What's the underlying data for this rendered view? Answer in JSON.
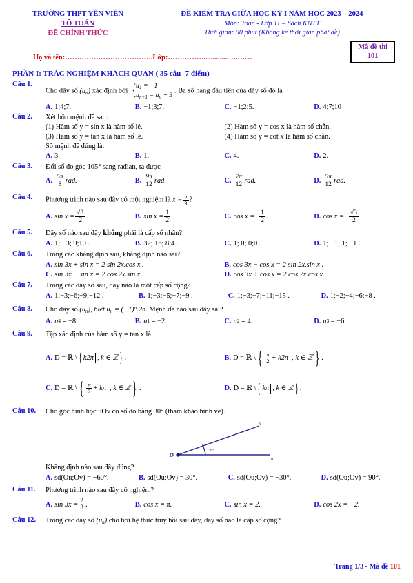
{
  "header": {
    "school": "TRƯỜNG THPT YÊN VIÊN",
    "department": "TỔ TOÁN",
    "official": "ĐỀ CHÍNH THỨC",
    "exam_title": "ĐỀ KIỂM TRA GIỮA HỌC KỲ I NĂM HỌC 2023 – 2024",
    "subject": "Môn: Toán - Lớp 11 – Sách KNTT",
    "duration": "Thời gian: 90 phút (Không kể thời gian phát đề)"
  },
  "student": {
    "name_label": "Họ và tên:……………………………….",
    "class_label": "Lớp:……………..............….……",
    "code_title": "Mã đề thi",
    "code_value": "101"
  },
  "part_heading": "PHẦN I: TRẮC NGHIỆM KHÁCH QUAN ( 35 câu- 7 điểm)",
  "questions": [
    {
      "label": "Câu 1.",
      "stem_pre": "Cho dãy số",
      "stem_seq": "(u",
      "stem_seq_sub": "n",
      "stem_seq_post": ")",
      "stem_mid": "xác định bởi",
      "sys_line1_a": "u",
      "sys_line1_sub": "1",
      "sys_line1_b": "= −1",
      "sys_line2_a": "u",
      "sys_line2_sub": "n+1",
      "sys_line2_b": "= u",
      "sys_line2_sub2": "n",
      "sys_line2_c": "+ 3",
      "stem_post": ". Ba số hạng đầu tiên của dãy số đó là",
      "options": [
        {
          "letter": "A.",
          "text": "1;4;7."
        },
        {
          "letter": "B.",
          "text": "−1;3;7."
        },
        {
          "letter": "C.",
          "text": "−1;2;5."
        },
        {
          "letter": "D.",
          "text": "4;7;10"
        }
      ]
    },
    {
      "label": "Câu 2.",
      "stem": "Xét bốn mệnh đề sau:",
      "statements": [
        "(1) Hàm số  y = sin x  là hàm số lẻ.",
        "(2) Hàm số  y = cos x  là hàm số chẵn.",
        "(3) Hàm số  y = tan x  là hàm số lẻ.",
        "(4) Hàm số  y = cot x  là hàm số chẵn."
      ],
      "stem2": "Số mệnh đề đúng là:",
      "options": [
        {
          "letter": "A.",
          "text": "3."
        },
        {
          "letter": "B.",
          "text": "1."
        },
        {
          "letter": "C.",
          "text": "4."
        },
        {
          "letter": "D.",
          "text": "2."
        }
      ]
    },
    {
      "label": "Câu 3.",
      "stem": "Đổi số đo góc 105° sang rađian, ta được",
      "options": [
        {
          "letter": "A.",
          "num": "5π",
          "den": "8",
          "unit": "rad."
        },
        {
          "letter": "B.",
          "num": "9π",
          "den": "12",
          "unit": "rad."
        },
        {
          "letter": "C.",
          "num": "7π",
          "den": "12",
          "unit": "rad."
        },
        {
          "letter": "D.",
          "num": "5π",
          "den": "12",
          "unit": "rad."
        }
      ]
    },
    {
      "label": "Câu 4.",
      "stem_pre": "Phương trình nào sau đây có một nghiệm là",
      "stem_x": "x =",
      "stem_num": "π",
      "stem_den": "3",
      "stem_post": "?",
      "options": [
        {
          "letter": "A.",
          "lhs": "sin x =",
          "sign": "",
          "num": "√3",
          "den": "2",
          "tail": "."
        },
        {
          "letter": "B.",
          "lhs": "sin x =",
          "sign": "",
          "num": "1",
          "den": "2",
          "tail": "."
        },
        {
          "letter": "C.",
          "lhs": "cos x =",
          "sign": "−",
          "num": "1",
          "den": "2",
          "tail": "."
        },
        {
          "letter": "D.",
          "lhs": "cos x =",
          "sign": "−",
          "num": "√3",
          "den": "2",
          "tail": "."
        }
      ]
    },
    {
      "label": "Câu 5.",
      "stem_pre": "Dãy số nào sau đây",
      "stem_bold": "không",
      "stem_post": "phải là cấp số nhân?",
      "options": [
        {
          "letter": "A.",
          "text": "1; −3; 9;10 ."
        },
        {
          "letter": "B.",
          "text": "32; 16; 8;4 ."
        },
        {
          "letter": "C.",
          "text": "1; 0; 0;0 ."
        },
        {
          "letter": "D.",
          "text": "1; −1; 1; −1 ."
        }
      ]
    },
    {
      "label": "Câu 6.",
      "stem": "Trong các khẳng định sau, khẳng định nào sai?",
      "options": [
        {
          "letter": "A.",
          "text": "sin 3x + sin x = 2 sin 2x.cos x ."
        },
        {
          "letter": "B.",
          "text": "cos 3x − cos x = 2 sin 2x.sin x ."
        },
        {
          "letter": "C.",
          "text": "sin 3x − sin x = 2 cos 2x.sin x ."
        },
        {
          "letter": "D.",
          "text": "cos 3x + cos x = 2 cos 2x.cos x ."
        }
      ]
    },
    {
      "label": "Câu 7.",
      "stem": "Trong các dãy số sau, dãy nào là một cấp số cộng?",
      "options": [
        {
          "letter": "A.",
          "text": "1;−3;−6;−9;−12 ."
        },
        {
          "letter": "B.",
          "text": "1;−3;−5;−7;−9 ."
        },
        {
          "letter": "C.",
          "text": "1;−3;−7;−11;−15 ."
        },
        {
          "letter": "D.",
          "text": "1;−2;−4;−6;−8 ."
        }
      ]
    },
    {
      "label": "Câu 8.",
      "stem_pre": "Cho dãy số",
      "stem_seq": "(u",
      "stem_seq_sub": "n",
      "stem_seq_post": "),",
      "stem_mid": "biết u",
      "stem_mid_sub": "n",
      "stem_mid2": "= (−1)",
      "stem_mid_sup": "n",
      "stem_mid3": ".2n.",
      "stem_post": "Mệnh đề nào sau đây sai?",
      "options": [
        {
          "letter": "A.",
          "v": "u",
          "sub": "4",
          "text": "= −8."
        },
        {
          "letter": "B.",
          "v": "u",
          "sub": "1",
          "text": "= −2."
        },
        {
          "letter": "C.",
          "v": "u",
          "sub": "2",
          "text": "= 4."
        },
        {
          "letter": "D.",
          "v": "u",
          "sub": "3",
          "text": "= −6."
        }
      ]
    },
    {
      "label": "Câu 9.",
      "stem": "Tập xác định của hàm số  y = tan x  là",
      "options": [
        {
          "letter": "A.",
          "pre": "D = ℝ \\",
          "frac": false,
          "term": "k2π",
          "cond": ", k ∈ ℤ",
          "tail": "."
        },
        {
          "letter": "B.",
          "pre": "D = ℝ \\",
          "frac": true,
          "num": "π",
          "den": "2",
          "term": "+ k2π",
          "cond": ", k ∈ ℤ",
          "tail": "."
        },
        {
          "letter": "C.",
          "pre": "D = ℝ \\",
          "frac": true,
          "num": "π",
          "den": "2",
          "term": "+ kπ",
          "cond": ", k ∈ ℤ",
          "tail": "."
        },
        {
          "letter": "D.",
          "pre": "D = ℝ \\",
          "frac": false,
          "term": "kπ",
          "cond": ", k ∈ ℤ",
          "tail": "."
        }
      ]
    },
    {
      "label": "Câu 10.",
      "stem": "Cho góc hình học  uOv  có số đo bằng  30° (tham khảo hình vẽ).",
      "figure": {
        "vertex": "O",
        "ray_u": "u",
        "ray_v": "v",
        "angle": "30°"
      },
      "stem2": "Khẳng định nào sau đây đúng?",
      "options": [
        {
          "letter": "A.",
          "text": "sd(Ou;Ov) = −60°."
        },
        {
          "letter": "B.",
          "text": "sd(Ou;Ov) = 30°."
        },
        {
          "letter": "C.",
          "text": "sd(Ou;Ov) = −30°."
        },
        {
          "letter": "D.",
          "text": "sd(Ou;Ov) = 90°."
        }
      ]
    },
    {
      "label": "Câu 11.",
      "stem": "Phương trình nào sau đây có nghiệm?",
      "options": [
        {
          "letter": "A.",
          "lhs": "sin 3x =",
          "num": "2",
          "den": "3",
          "tail": "."
        },
        {
          "letter": "B.",
          "text": "cos x = π."
        },
        {
          "letter": "C.",
          "text": "sin x = 2."
        },
        {
          "letter": "D.",
          "text": "cos 2x = −2."
        }
      ]
    },
    {
      "label": "Câu 12.",
      "stem_pre": "Trong các dãy số",
      "stem_seq": "(u",
      "stem_seq_sub": "n",
      "stem_seq_post": ")",
      "stem_post": "cho bởi hệ thức truy hồi sau đây, dãy số nào là cấp số cộng?"
    }
  ],
  "footer": {
    "text": "Trang 1/3 - Mã đề ",
    "code": "101"
  }
}
